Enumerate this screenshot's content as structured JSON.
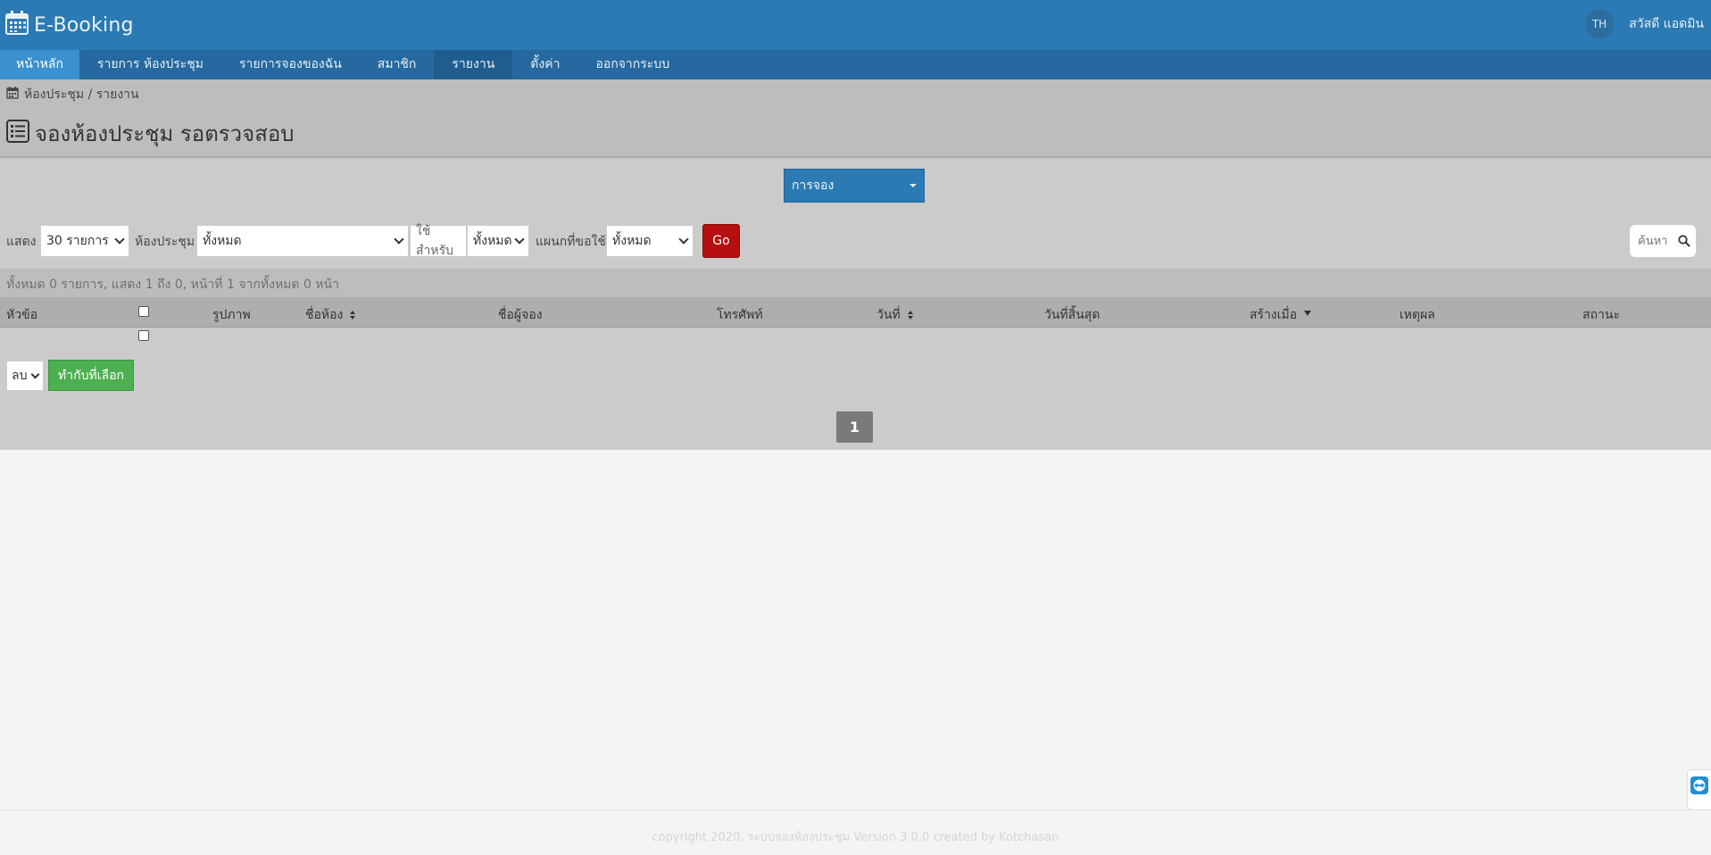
{
  "app": {
    "title": "E-Booking",
    "language": "TH",
    "greeting": "สวัสดี แอดมิน"
  },
  "nav": {
    "items": [
      {
        "label": "หน้าหลัก"
      },
      {
        "label": "รายการ ห้องประชุม"
      },
      {
        "label": "รายการจองของฉัน"
      },
      {
        "label": "สมาชิก"
      },
      {
        "label": "รายงาน"
      },
      {
        "label": "ตั้งค่า"
      },
      {
        "label": "ออกจากระบบ"
      }
    ]
  },
  "breadcrumb": "ห้องประชุม / รายงาน",
  "page": {
    "title": "จองห้องประชุม รอตรวจสอบ"
  },
  "type_select": {
    "value": "การจอง"
  },
  "filters": {
    "show_label": "แสดง",
    "show_value": "30 รายการ",
    "room_label": "ห้องประชุม",
    "room_value": "ทั้งหมด",
    "use_for_label": "ใช้สำหรับ",
    "use_for_value": "ทั้งหมด",
    "dept_label": "แผนกที่ขอใช้",
    "dept_value": "ทั้งหมด",
    "go_label": "Go",
    "search_placeholder": "ค้นหา"
  },
  "summary": "ทั้งหมด 0 รายการ, แสดง 1 ถึง 0, หน้าที่ 1 จากทั้งหมด 0 หน้า",
  "table": {
    "columns": [
      "หัวข้อ",
      "รูปภาพ",
      "ชื่อห้อง",
      "ชื่อผู้จอง",
      "โทรศัพท์",
      "วันที่",
      "วันที่สิ้นสุด",
      "สร้างเมื่อ",
      "เหตุผล",
      "สถานะ"
    ]
  },
  "bulk": {
    "action_value": "ลบ",
    "apply_label": "ทำกับที่เลือก"
  },
  "pagination": {
    "current": "1"
  },
  "footer": "copyright 2020, ระบบจองห้องประชุม Version 3.0.0 created by Kotchasan",
  "colors": {
    "header": "#2b7ab3",
    "nav": "#2569a0",
    "go_button": "#b50f0f",
    "apply_button": "#4caf50"
  }
}
